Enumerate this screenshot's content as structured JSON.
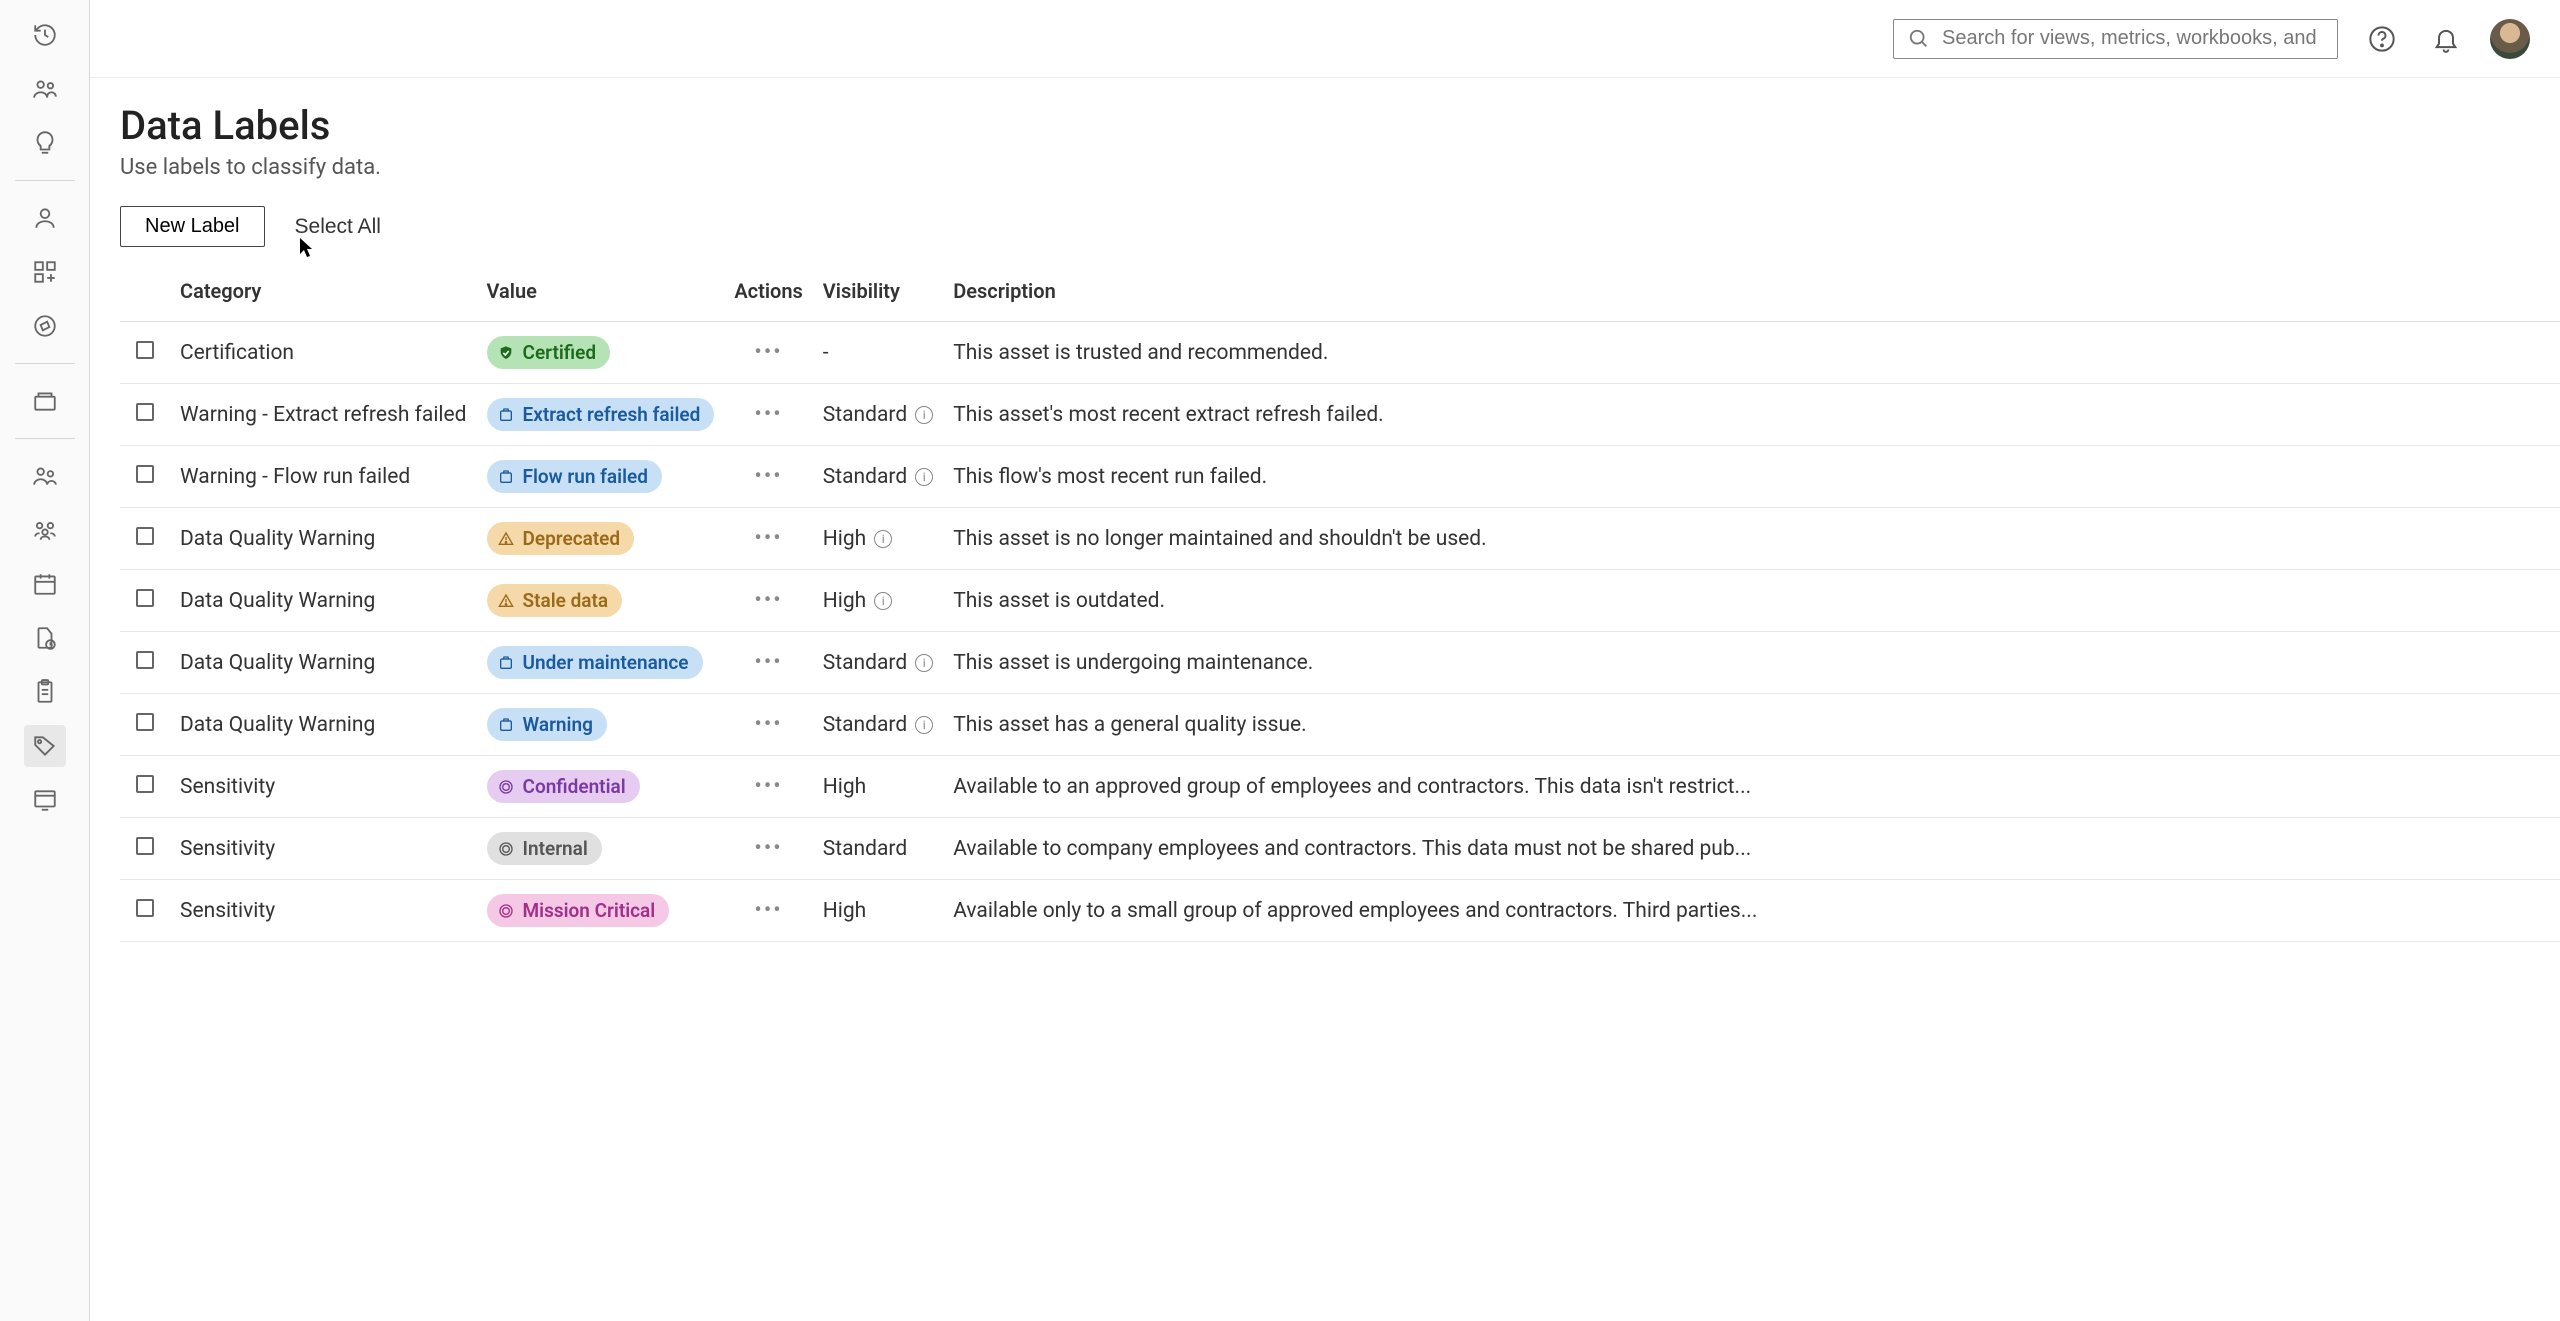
{
  "header": {
    "search_placeholder": "Search for views, metrics, workbooks, and more"
  },
  "page": {
    "title": "Data Labels",
    "subtitle": "Use labels to classify data.",
    "new_label_btn": "New Label",
    "select_all_btn": "Select All"
  },
  "columns": {
    "category": "Category",
    "value": "Value",
    "actions": "Actions",
    "visibility": "Visibility",
    "description": "Description"
  },
  "rows": [
    {
      "category": "Certification",
      "value": "Certified",
      "pill_color": "green",
      "visibility": "-",
      "vis_info": false,
      "description": "This asset is trusted and recommended."
    },
    {
      "category": "Warning - Extract refresh failed",
      "value": "Extract refresh failed",
      "pill_color": "blue",
      "visibility": "Standard",
      "vis_info": true,
      "description": "This asset's most recent extract refresh failed."
    },
    {
      "category": "Warning - Flow run failed",
      "value": "Flow run failed",
      "pill_color": "blue",
      "visibility": "Standard",
      "vis_info": true,
      "description": "This flow's most recent run failed."
    },
    {
      "category": "Data Quality Warning",
      "value": "Deprecated",
      "pill_color": "orange",
      "visibility": "High",
      "vis_info": true,
      "description": "This asset is no longer maintained and shouldn't be used."
    },
    {
      "category": "Data Quality Warning",
      "value": "Stale data",
      "pill_color": "orange",
      "visibility": "High",
      "vis_info": true,
      "description": "This asset is outdated."
    },
    {
      "category": "Data Quality Warning",
      "value": "Under maintenance",
      "pill_color": "blue",
      "visibility": "Standard",
      "vis_info": true,
      "description": "This asset is undergoing maintenance."
    },
    {
      "category": "Data Quality Warning",
      "value": "Warning",
      "pill_color": "blue",
      "visibility": "Standard",
      "vis_info": true,
      "description": "This asset has a general quality issue."
    },
    {
      "category": "Sensitivity",
      "value": "Confidential",
      "pill_color": "purple",
      "visibility": "High",
      "vis_info": false,
      "description": "Available to an approved group of employees and contractors. This data isn't restrict..."
    },
    {
      "category": "Sensitivity",
      "value": "Internal",
      "pill_color": "grey",
      "visibility": "Standard",
      "vis_info": false,
      "description": "Available to company employees and contractors. This data must not be shared pub..."
    },
    {
      "category": "Sensitivity",
      "value": "Mission Critical",
      "pill_color": "pink",
      "visibility": "High",
      "vis_info": false,
      "description": "Available only to a small group of approved employees and contractors. Third parties..."
    }
  ]
}
